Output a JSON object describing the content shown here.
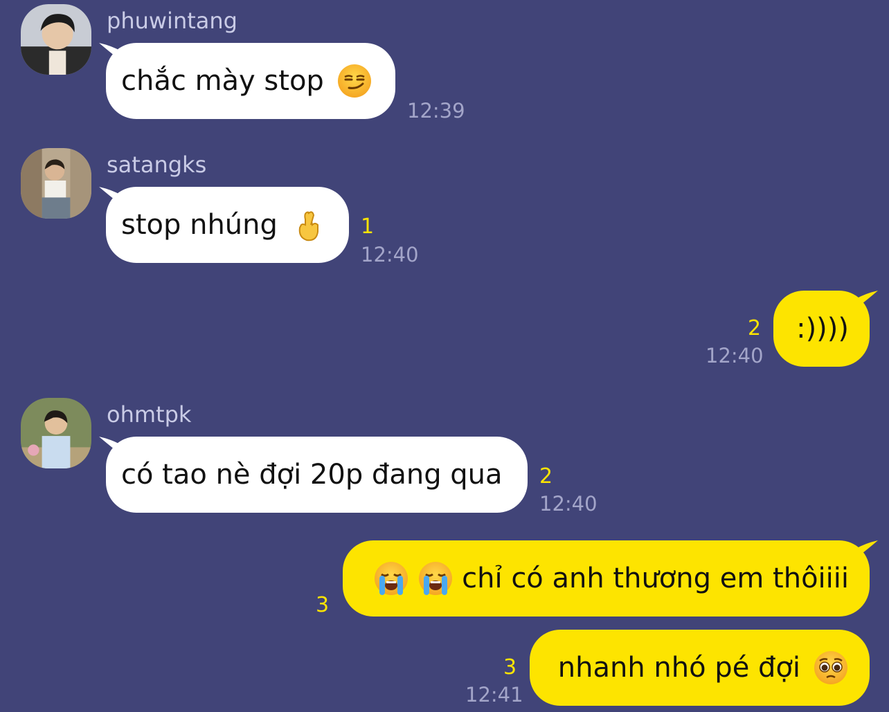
{
  "colors": {
    "background": "#414478",
    "incoming_bubble": "#ffffff",
    "outgoing_bubble": "#fde400",
    "read_count": "#fde400",
    "timestamp": "#a3a5c9",
    "sender_name": "#c9cbe6"
  },
  "messages": [
    {
      "direction": "incoming",
      "sender": "phuwintang",
      "text": "chắc mày stop",
      "emoji": "smirking-face-icon",
      "read_count": "",
      "time": "12:39"
    },
    {
      "direction": "incoming",
      "sender": "satangks",
      "text": "stop nhúng",
      "emoji": "crossed-fingers-icon",
      "read_count": "1",
      "time": "12:40"
    },
    {
      "direction": "outgoing",
      "text": ":))))",
      "read_count": "2",
      "time": "12:40"
    },
    {
      "direction": "incoming",
      "sender": "ohmtpk",
      "text": "có tao nè đợi 20p đang qua",
      "read_count": "2",
      "time": "12:40"
    },
    {
      "direction": "outgoing",
      "text": "chỉ có anh thương em thôiiii",
      "emoji": "loudly-crying-face-icon",
      "emoji_count": 2,
      "read_count": "3",
      "time": ""
    },
    {
      "direction": "outgoing",
      "text": "nhanh nhó pé đợi",
      "emoji": "pleading-face-icon",
      "read_count": "3",
      "time": "12:41"
    }
  ]
}
